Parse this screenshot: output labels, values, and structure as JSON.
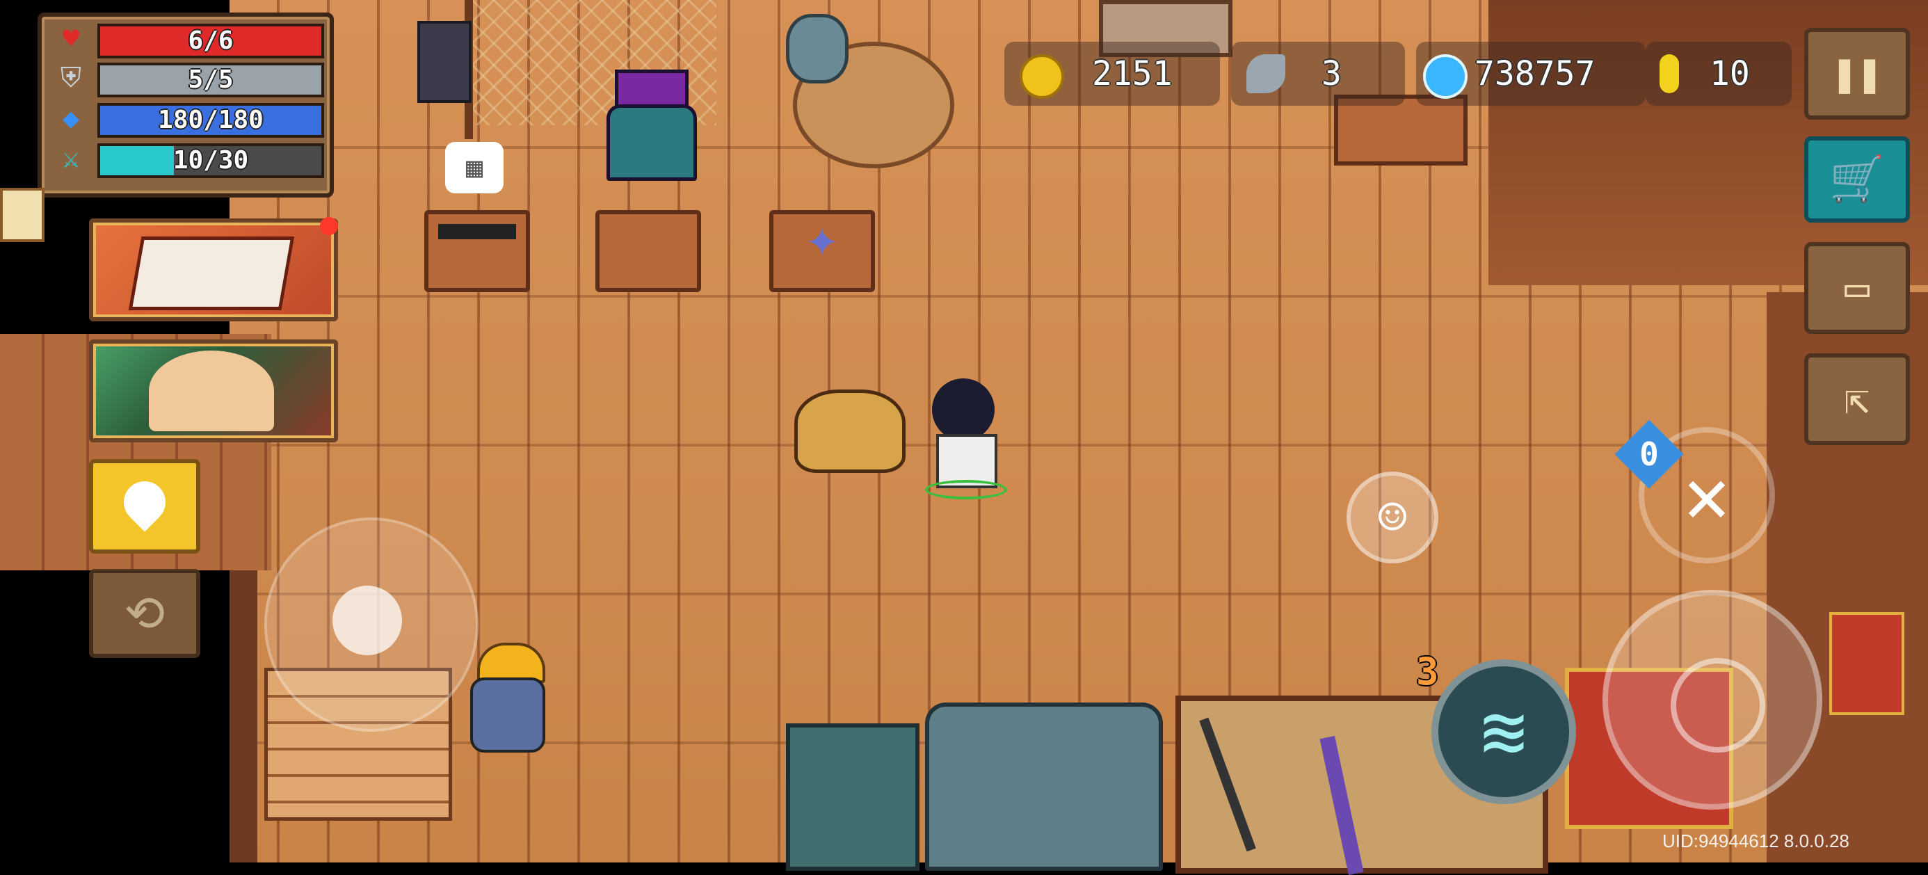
{
  "stats": {
    "hp": {
      "label": "6/6",
      "fill": 1.0,
      "color": "#e02a2a",
      "icon": "heart-icon"
    },
    "armor": {
      "label": "5/5",
      "fill": 1.0,
      "color": "#9aa3a9",
      "icon": "shield-icon"
    },
    "energy": {
      "label": "180/180",
      "fill": 1.0,
      "color": "#3a6fe0",
      "icon": "diamond-icon"
    },
    "skill": {
      "label": "10/30",
      "fill": 0.333,
      "color": "#29c9c9",
      "icon": "sword-icon"
    }
  },
  "currencies": {
    "gold": {
      "value": "2151",
      "icon": "gold-coin-icon"
    },
    "fish": {
      "value": "3",
      "icon": "fish-icon"
    },
    "gems": {
      "value": "738757",
      "icon": "gem-icon"
    },
    "tokens": {
      "value": "10",
      "icon": "token-icon"
    }
  },
  "buttons": {
    "pause": "pause-icon",
    "shop": "cart-icon",
    "profile": "profile-card-icon",
    "exit": "exit-icon",
    "emote": "smile-icon",
    "location": "location-pin-icon",
    "swap": "swap-icon"
  },
  "combat": {
    "skill_cooldown": "3",
    "weapon_slot_energy": "0"
  },
  "uid": "UID:94944612 8.0.0.28",
  "colors": {
    "floor": "#d08b50",
    "panel": "#8a6440",
    "accent": "#f3c52a",
    "shop": "#1a8f95"
  }
}
